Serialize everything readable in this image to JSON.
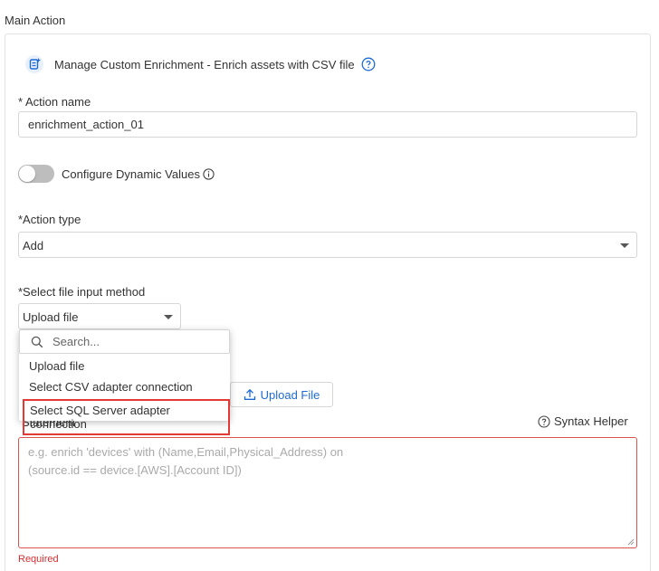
{
  "section": {
    "title": "Main Action"
  },
  "header": {
    "text": "Manage Custom Enrichment - Enrich assets with CSV file",
    "icon": "enrichment-icon",
    "help_icon": "question-circle-icon"
  },
  "action_name": {
    "label": "* Action name",
    "value": "enrichment_action_01"
  },
  "dynamic_values": {
    "label": "Configure Dynamic Values",
    "enabled": false
  },
  "action_type": {
    "label": "*Action type",
    "value": "Add"
  },
  "file_input": {
    "label": "*Select file input method",
    "value": "Upload file"
  },
  "dropdown": {
    "search_placeholder": "Search...",
    "options": [
      "Upload file",
      "Select CSV adapter connection",
      "Select SQL Server adapter connection"
    ]
  },
  "upload": {
    "label": "Upload File"
  },
  "statement": {
    "label": "Statement",
    "syntax_helper": "Syntax Helper",
    "placeholder_line1": "e.g. enrich 'devices' with (Name,Email,Physical_Address) on",
    "placeholder_line2": "(source.id == device.[AWS].[Account ID])",
    "error": "Required"
  },
  "colors": {
    "accent": "#1e6bd6",
    "error": "#d32f2f",
    "highlight_border": "#e53935"
  }
}
